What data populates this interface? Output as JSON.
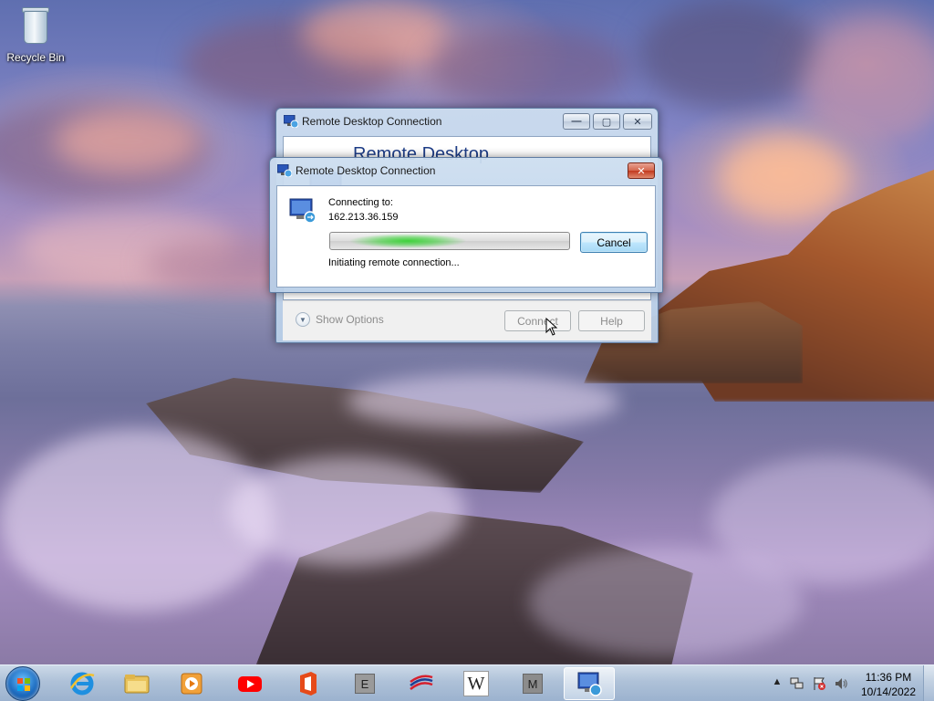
{
  "desktop": {
    "icons": [
      {
        "label": "Recycle Bin",
        "icon": "recycle-bin-icon"
      }
    ]
  },
  "rdc_main_window": {
    "title": "Remote Desktop Connection",
    "banner": "Remote Desktop",
    "show_options": "Show Options",
    "connect_label": "Connect",
    "help_label": "Help",
    "controls": {
      "minimize": "minimize-icon",
      "maximize": "maximize-icon",
      "close": "close-icon"
    }
  },
  "rdc_progress_dialog": {
    "title": "Remote Desktop Connection",
    "connecting_to": "Connecting to:",
    "address": "162.213.36.159",
    "status": "Initiating remote connection...",
    "cancel_label": "Cancel",
    "progress": "indeterminate"
  },
  "taskbar": {
    "start": "windows-start-icon",
    "items": [
      {
        "name": "internet-explorer",
        "icon": "internet-explorer-icon"
      },
      {
        "name": "file-explorer",
        "icon": "folder-icon"
      },
      {
        "name": "media-player",
        "icon": "media-player-icon"
      },
      {
        "name": "youtube",
        "icon": "youtube-icon"
      },
      {
        "name": "office",
        "icon": "office-icon"
      },
      {
        "name": "e-app",
        "icon": "letter-e-icon",
        "letter": "E"
      },
      {
        "name": "bank-of-america",
        "icon": "bank-flag-icon"
      },
      {
        "name": "wikipedia",
        "icon": "wikipedia-icon",
        "letter": "W"
      },
      {
        "name": "m-app",
        "icon": "letter-m-icon",
        "letter": "M"
      },
      {
        "name": "remote-desktop",
        "icon": "remote-desktop-icon",
        "active": true
      }
    ],
    "tray": {
      "icons": [
        "show-hidden-icons-icon",
        "network-icon",
        "action-center-icon",
        "volume-icon"
      ],
      "time": "11:36 PM",
      "date": "10/14/2022"
    }
  },
  "colors": {
    "accent_blue": "#1e3d87",
    "close_red": "#c2391f",
    "progress_green": "#3ed23a"
  }
}
